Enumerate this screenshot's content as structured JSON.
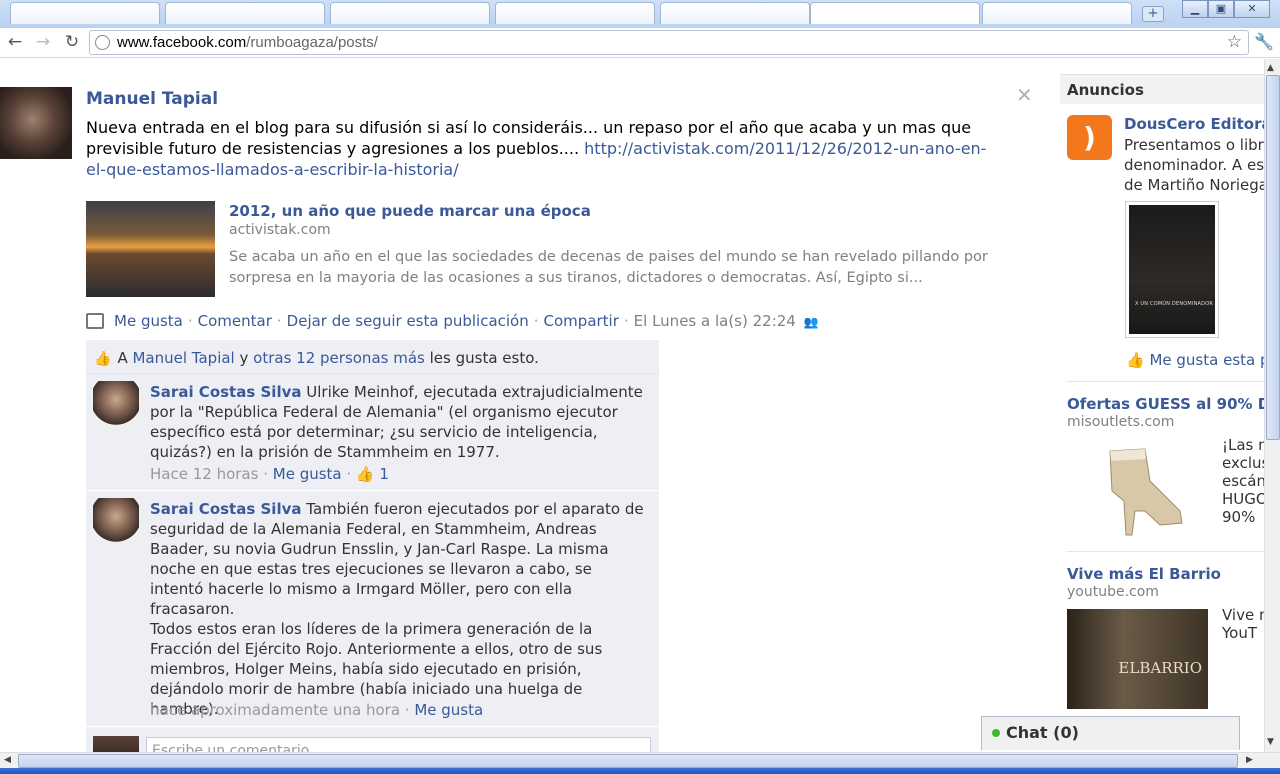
{
  "browser": {
    "url_domain": "www.facebook.com",
    "url_path": "/rumboagaza/posts/",
    "newtab_label": "+",
    "win_min": "▁",
    "win_max": "▣",
    "win_close": "✕"
  },
  "post": {
    "author": "Manuel Tapial",
    "message": "Nueva entrada en el blog para su difusión si así lo consideráis... un repaso por el año que acaba y un mas que previsible futuro de resistencias y agresiones a los pueblos.... ",
    "message_link": "http://activistak.com/2011/12/26/2012-un-ano-en-el-que-estamos-llamados-a-escribir-la-historia/",
    "link_title": "2012, un año que puede marcar una época",
    "link_domain": "activistak.com",
    "link_desc": "Se acaba un año en el que las sociedades de decenas de paises del mundo se han revelado pillando por sorpresa en la mayoria de las ocasiones a sus tiranos, dictadores o democratas. Así, Egipto si...",
    "actions": {
      "like": "Me gusta",
      "comment": "Comentar",
      "unfollow": "Dejar de seguir esta publicación",
      "share": "Compartir",
      "timestamp": "El Lunes a la(s) 22:24"
    },
    "likes": {
      "prefix": "A",
      "person": "Manuel Tapial",
      "and": "y",
      "others": "otras 12 personas más",
      "suffix": "les gusta esto."
    }
  },
  "comments": [
    {
      "name": "Sarai Costas Silva",
      "text": "Ulrike Meinhof, ejecutada extrajudicialmente por la \"República Federal de Alemania\" (el organismo ejecutor específico está por determinar; ¿su servicio de inteligencia, quizás?) en la prisión de Stammheim en 1977.",
      "time": "Hace 12 horas",
      "like": "Me gusta",
      "like_count": "1"
    },
    {
      "name": "Sarai Costas Silva",
      "text": "También fueron ejecutados por el aparato de seguridad de la Alemania Federal, en Stammheim, Andreas Baader, su novia Gudrun Ensslin, y Jan-Carl Raspe. La misma noche en que estas tres ejecuciones se llevaron a cabo, se intentó hacerle lo mismo a Irmgard Möller, pero con ella fracasaron.",
      "text2": "Todos estos eran los líderes de la primera generación de la Fracción del Ejército Rojo. Anteriormente a ellos, otro de sus miembros, Holger Meins, había sido ejecutado en prisión, dejándolo morir de hambre (había iniciado una huelga de hambre).",
      "time": "hace aproximadamente una hora",
      "like": "Me gusta"
    }
  ],
  "write_comment_placeholder": "Escribe un comentario...",
  "sidebar": {
    "ads_heading": "Anuncios",
    "ads": [
      {
        "title": "DousCero Editora",
        "line1": "Presentamos o libro",
        "line2": "denominador. A ese",
        "line3": "de Martiño Noriega",
        "book_text": "X UN COMÚN DENOMINADOR",
        "like": "Me gusta esta pá"
      },
      {
        "title": "Ofertas GUESS al 90% D",
        "domain": "misoutlets.com",
        "line1": "¡Las m",
        "line2": "exclus",
        "line3": "escán",
        "line4": "HUGO",
        "line5": "90%"
      },
      {
        "title": "Vive más El Barrio",
        "domain": "youtube.com",
        "line1": "Vive m",
        "line2": "YouT",
        "image_text": "ELBARRIO"
      }
    ]
  },
  "chat": {
    "label": "Chat (0)"
  }
}
